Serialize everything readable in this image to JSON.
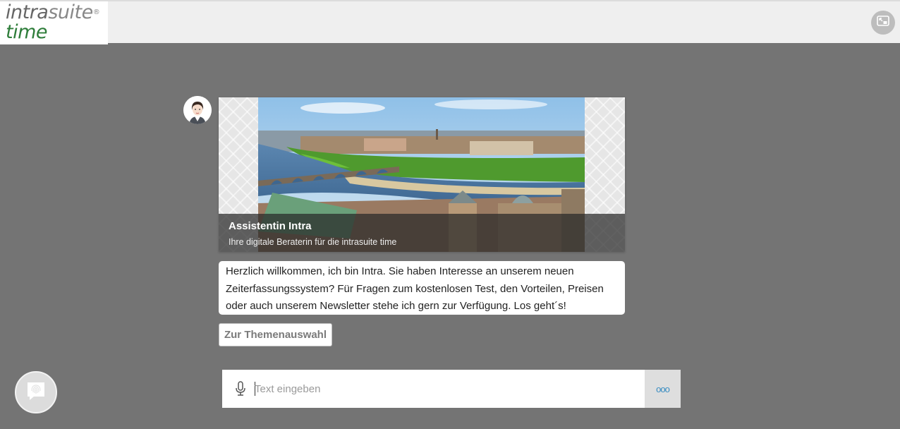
{
  "logo": {
    "line1_intra": "intra",
    "line1_suite": "suite",
    "registered": "®",
    "line2": "time"
  },
  "header": {
    "corner_icon": "picture-in-picture-icon"
  },
  "chat": {
    "avatar_icon": "assistant-avatar",
    "card": {
      "image": "dresden-panorama",
      "title": "Assistentin Intra",
      "subtitle": "Ihre digitale Beraterin für die intrasuite time"
    },
    "message": "Herzlich willkommen, ich bin Intra. Sie haben Interesse an unserem neuen Zeiterfassungssystem? Für Fragen zum kostenlosen Test, den Vorteilen, Preisen oder auch unserem Newsletter stehe ich gern zur Verfügung. Los geht´s!",
    "topic_button": "Zur Themenauswahl"
  },
  "input": {
    "placeholder": "Text eingeben",
    "mic_icon": "microphone-icon",
    "more_icon": "more-options-icon",
    "more_label": "ooo"
  },
  "fab": {
    "icon": "fingerprint-chat-icon"
  },
  "colors": {
    "background": "#747474",
    "topbar": "#efefef",
    "brand_green": "#2e7d3a",
    "accent_blue": "#3b8ec2"
  }
}
